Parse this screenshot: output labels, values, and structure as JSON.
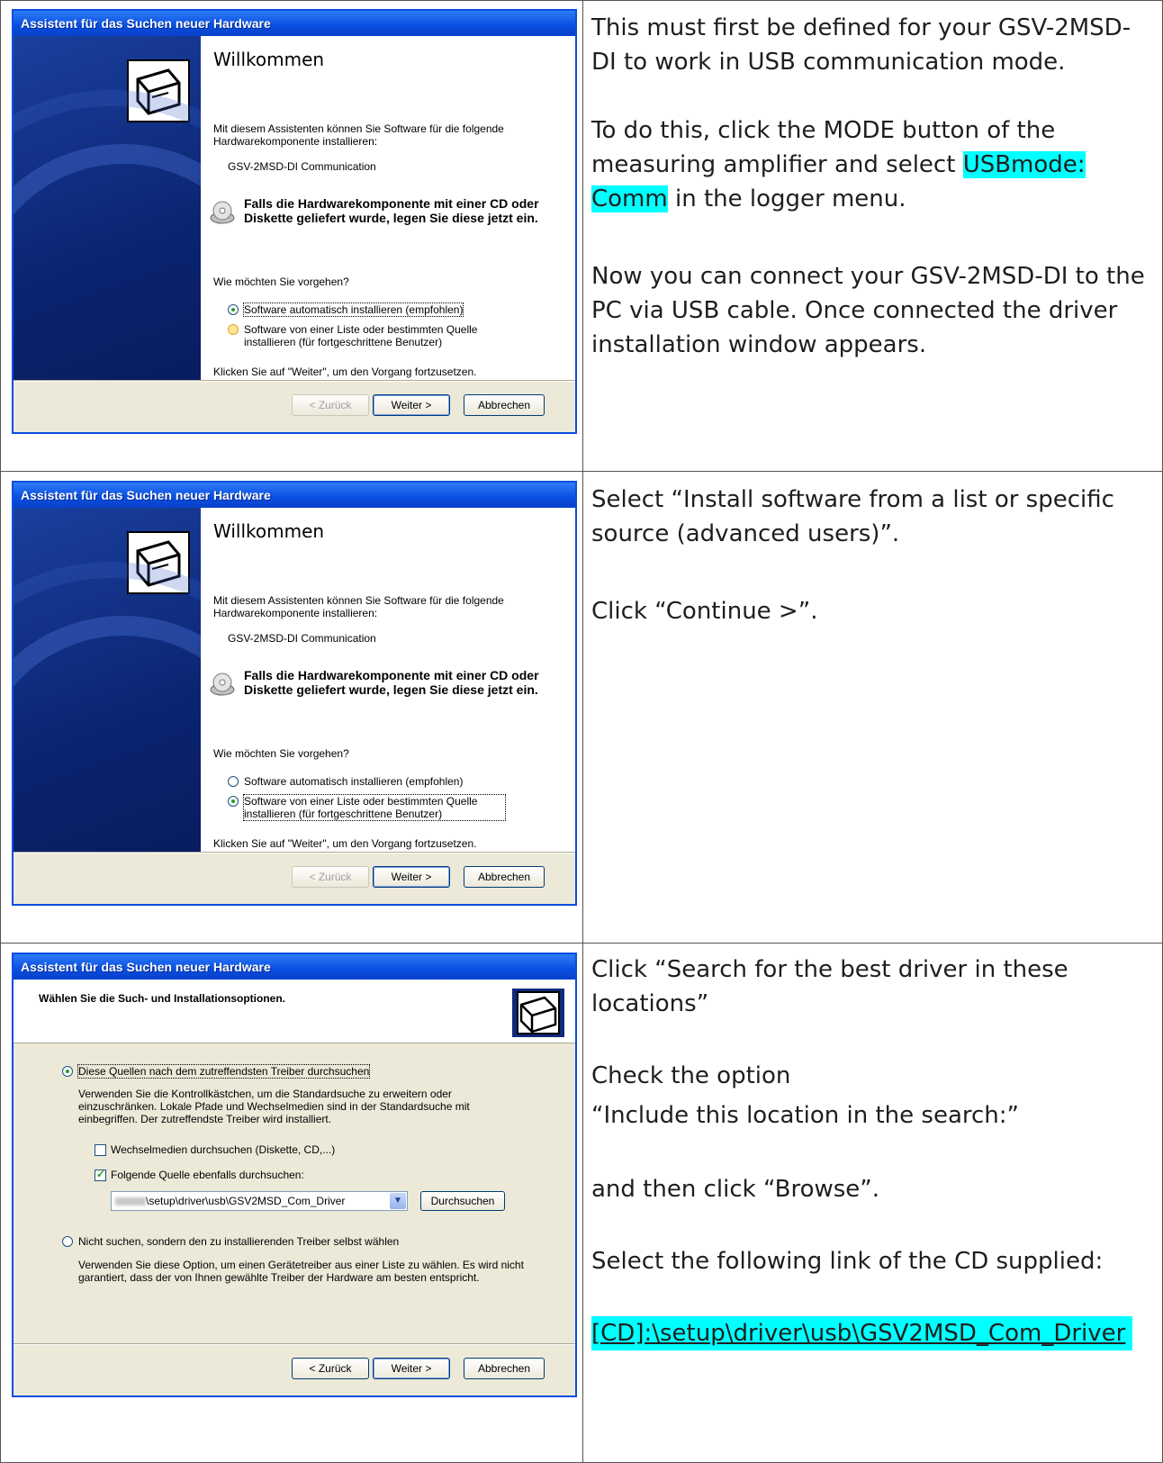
{
  "rows": [
    {
      "dialog": {
        "title": "Assistent für das Suchen neuer Hardware",
        "heading": "Willkommen",
        "intro": "Mit diesem Assistenten können Sie Software für die folgende Hardwarekomponente installieren:",
        "device": "GSV-2MSD-DI Communication",
        "cd_notice": "Falls die Hardwarekomponente mit einer CD oder Diskette geliefert wurde, legen Sie diese jetzt ein.",
        "question": "Wie möchten Sie vorgehen?",
        "option_auto": "Software automatisch installieren (empfohlen)",
        "option_list": "Software von einer Liste oder bestimmten Quelle installieren (für fortgeschrittene Benutzer)",
        "continue_hint": "Klicken Sie auf \"Weiter\", um den Vorgang fortzusetzen.",
        "selected": "auto",
        "back": "< Zurück",
        "next": "Weiter >",
        "cancel": "Abbrechen"
      },
      "text": {
        "p1": "This must first be defined for your GSV-2MSD-DI to work in USB communication mode.",
        "p2_before": "To do this, click the MODE button of the measuring amplifier and select ",
        "p2_highlight1": "USBmode:",
        "p2_highlight2": "Comm",
        "p2_after": " in the logger menu.",
        "p3": "Now you can connect your GSV-2MSD-DI to the PC via USB cable. Once connected the driver installation window appears."
      }
    },
    {
      "dialog": {
        "title": "Assistent für das Suchen neuer Hardware",
        "heading": "Willkommen",
        "intro": "Mit diesem Assistenten können Sie Software für die folgende Hardwarekomponente installieren:",
        "device": "GSV-2MSD-DI Communication",
        "cd_notice": "Falls die Hardwarekomponente mit einer CD oder Diskette geliefert wurde, legen Sie diese jetzt ein.",
        "question": "Wie möchten Sie vorgehen?",
        "option_auto": "Software automatisch installieren (empfohlen)",
        "option_list": "Software von einer Liste oder bestimmten Quelle installieren (für fortgeschrittene Benutzer)",
        "continue_hint": "Klicken Sie auf \"Weiter\", um den Vorgang fortzusetzen.",
        "selected": "list",
        "back": "< Zurück",
        "next": "Weiter >",
        "cancel": "Abbrechen"
      },
      "text": {
        "p1": "Select “Install software from a list or specific source (advanced users)”.",
        "p2": "Click “Continue >”."
      }
    },
    {
      "dialog": {
        "title": "Assistent für das Suchen neuer Hardware",
        "header": "Wählen Sie die Such- und Installationsoptionen.",
        "option_search": "Diese Quellen nach dem zutreffendsten Treiber durchsuchen",
        "search_desc": "Verwenden Sie die Kontrollkästchen, um die Standardsuche zu erweitern oder einzuschränken. Lokale Pfade und Wechselmedien sind in der Standardsuche mit einbegriffen. Der zutreffendste Treiber wird installiert.",
        "check_removable": "Wechselmedien durchsuchen (Diskette, CD,...)",
        "check_include": "Folgende Quelle ebenfalls durchsuchen:",
        "path_value": "\\setup\\driver\\usb\\GSV2MSD_Com_Driver",
        "browse": "Durchsuchen",
        "option_manual": "Nicht suchen, sondern den zu installierenden Treiber selbst wählen",
        "manual_desc": "Verwenden Sie diese Option, um einen Gerätetreiber aus einer Liste zu wählen. Es wird nicht garantiert, dass der von Ihnen gewählte Treiber der Hardware am besten entspricht.",
        "back": "< Zurück",
        "next": "Weiter >",
        "cancel": "Abbrechen"
      },
      "text": {
        "p1": "Click “Search for the best driver in these locations”",
        "p2": "Check the option",
        "p3": "“Include this location in the search:”",
        "p4": "and then click “Browse”.",
        "p5": "Select the following link of the CD supplied:",
        "link": "[CD]:\\setup\\driver\\usb\\GSV2MSD_Com_Driver"
      }
    }
  ]
}
